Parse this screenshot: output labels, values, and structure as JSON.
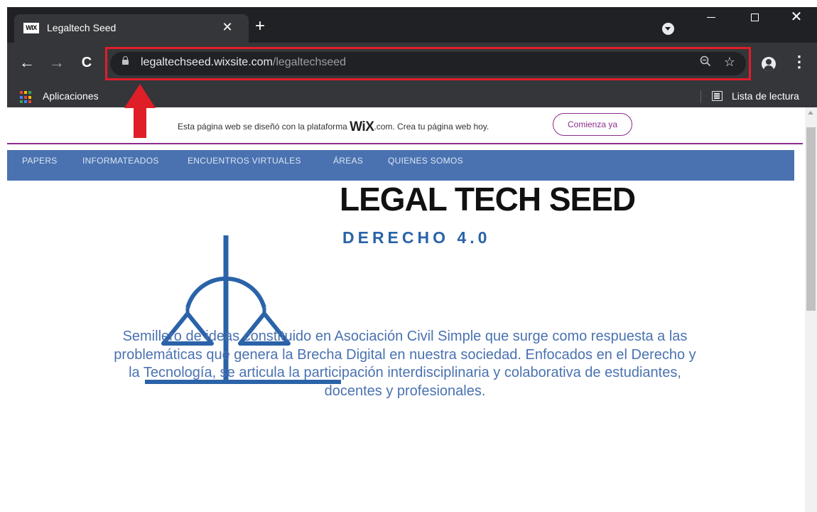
{
  "browser": {
    "tab": {
      "favicon_text": "WIX",
      "title": "Legaltech Seed",
      "close_glyph": "✕"
    },
    "new_tab_glyph": "+",
    "window_close_glyph": "✕",
    "nav": {
      "back_glyph": "←",
      "forward_glyph": "→",
      "reload_glyph": "C"
    },
    "address": {
      "host": "legaltechseed.wixsite.com",
      "path": "/legaltechseed"
    },
    "bookmarks": {
      "apps_label": "Aplicaciones",
      "reading_list_label": "Lista de lectura"
    },
    "colors": {
      "chrome_dark": "#202124",
      "toolbar": "#35363a",
      "highlight_red": "#e01e28"
    }
  },
  "wix_banner": {
    "text_before": "Esta página web se diseñó con la plataforma ",
    "logo": "WiX",
    "text_after": ".com. Crea tu página web hoy.",
    "cta_label": "Comienza ya",
    "accent_color": "#8c2c8c"
  },
  "site_nav": {
    "items": [
      "PAPERS",
      "INFORMATEADOS",
      "ENCUENTROS VIRTUALES",
      "ÁREAS",
      "QUIENES SOMOS"
    ],
    "bg_color": "#4a72b0"
  },
  "brand": {
    "title": "LEGAL TECH SEED",
    "subtitle": "DERECHO 4.0",
    "logo_icon": "scales-of-justice-icon",
    "logo_color": "#2a63a8"
  },
  "description": "Semillero de ideas constituido en Asociación Civil Simple que surge como respuesta a las problemáticas que genera la Brecha Digital en nuestra sociedad. Enfocados en el Derecho y la Tecnología, se articula la participación interdisciplinaria y colaborativa de estudiantes, docentes y profesionales."
}
